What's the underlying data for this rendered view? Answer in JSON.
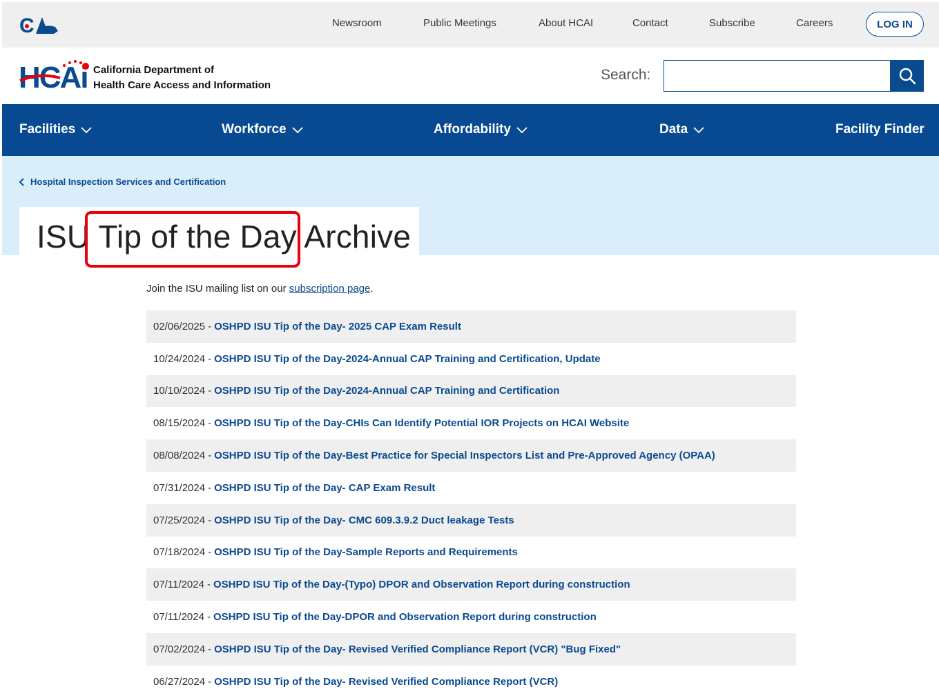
{
  "utility": {
    "logo_text": "CA",
    "links": [
      "Newsroom",
      "Public Meetings",
      "About HCAI",
      "Contact",
      "Subscribe",
      "Careers"
    ],
    "login_label": "LOG IN"
  },
  "brand": {
    "logo_text": "HCAi",
    "dept_line1": "California Department of",
    "dept_line2": "Health Care Access and Information"
  },
  "search": {
    "label": "Search:",
    "value": "",
    "placeholder": ""
  },
  "nav": {
    "items": [
      "Facilities",
      "Workforce",
      "Affordability",
      "Data",
      "Facility Finder"
    ]
  },
  "breadcrumb": "Hospital Inspection Services and Certification",
  "page_title": "ISU Tip of the Day Archive",
  "intro": {
    "prefix": "Join the ISU mailing list on our ",
    "link": "subscription page",
    "suffix": "."
  },
  "tips": [
    {
      "date": "02/06/2025",
      "title": "OSHPD ISU Tip of the Day- 2025 CAP Exam Result"
    },
    {
      "date": "10/24/2024",
      "title": "OSHPD ISU Tip of the Day-2024-Annual CAP Training and Certification, Update"
    },
    {
      "date": "10/10/2024",
      "title": "OSHPD ISU Tip of the Day-2024-Annual CAP Training and Certification"
    },
    {
      "date": "08/15/2024",
      "title": "OSHPD ISU Tip of the Day-CHIs Can Identify Potential IOR Projects on HCAI Website"
    },
    {
      "date": "08/08/2024",
      "title": "OSHPD ISU Tip of the Day-Best Practice for Special Inspectors List and Pre-Approved Agency (OPAA)"
    },
    {
      "date": "07/31/2024",
      "title": "OSHPD ISU Tip of the Day- CAP Exam Result"
    },
    {
      "date": "07/25/2024",
      "title": "OSHPD ISU Tip of the Day- CMC 609.3.9.2 Duct leakage Tests"
    },
    {
      "date": "07/18/2024",
      "title": "OSHPD ISU Tip of the Day-Sample Reports and Requirements"
    },
    {
      "date": "07/11/2024",
      "title": "OSHPD ISU Tip of the Day-(Typo) DPOR and Observation Report during construction"
    },
    {
      "date": "07/11/2024",
      "title": "OSHPD ISU Tip of the Day-DPOR and Observation Report during construction"
    },
    {
      "date": "07/02/2024",
      "title": "OSHPD ISU Tip of the Day- Revised Verified Compliance Report (VCR) \"Bug Fixed\""
    },
    {
      "date": "06/27/2024",
      "title": "OSHPD ISU Tip of the Day- Revised Verified Compliance Report (VCR)"
    }
  ],
  "separator": "-",
  "colors": {
    "brand_blue": "#084a92",
    "link_blue": "#0a4a8f",
    "hero_bg": "#d9eefa",
    "highlight_red": "#e8000b",
    "row_shade": "#efefef"
  }
}
